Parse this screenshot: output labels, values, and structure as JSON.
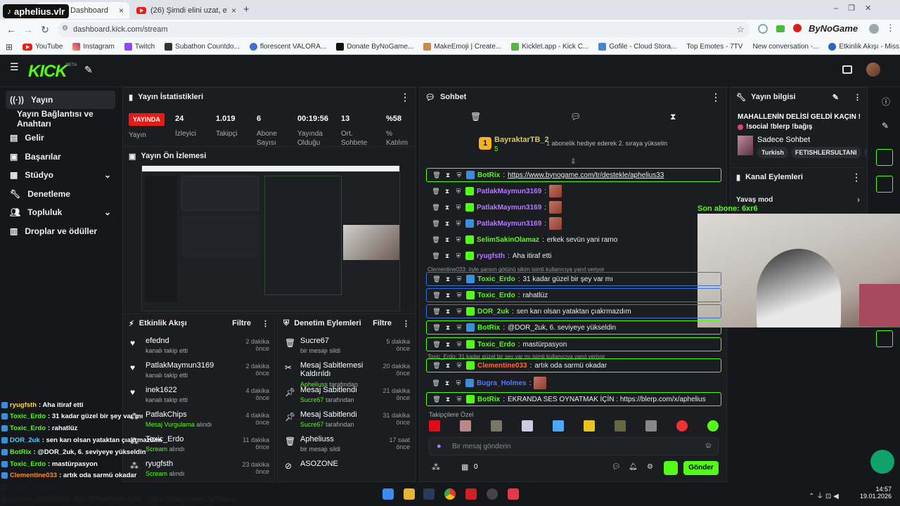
{
  "overlay_top": {
    "channel": "aphelius.vlr"
  },
  "browser": {
    "tabs": [
      {
        "label": "Dashboard",
        "close": "×"
      },
      {
        "label": "(26) Şimdi elini uzat, en güçlü o",
        "close": "×"
      }
    ],
    "new_tab": "+",
    "url": "dashboard.kick.com/stream",
    "profile_logo": "ByNoGame",
    "bookmarks": [
      "YouTube",
      "Instagram",
      "Twitch",
      "Subathon Countdo...",
      "florescent VALORA...",
      "Donate ByNoGame...",
      "MakeEmoji | Create...",
      "Kicklet.app - Kick C...",
      "Gofile - Cloud Stora...",
      "Top Emotes - 7TV",
      "New conversation -...",
      "Etkinlik Akışı - Miss..."
    ]
  },
  "kick": {
    "logo": "KICK",
    "logo_tag": "BETA",
    "sidebar": [
      {
        "label": "Yayın",
        "icon": "broadcast-icon"
      },
      {
        "label": "Yayın Bağlantısı ve Anahtarı",
        "icon": "none"
      },
      {
        "label": "Gelir",
        "icon": "wallet-icon"
      },
      {
        "label": "Başarılar",
        "icon": "trophy-icon"
      },
      {
        "label": "Stüdyo",
        "icon": "studio-icon"
      },
      {
        "label": "Denetleme",
        "icon": "wrench-icon"
      },
      {
        "label": "Topluluk",
        "icon": "users-icon"
      },
      {
        "label": "Droplar ve ödüller",
        "icon": "gift-icon"
      }
    ],
    "stats": {
      "title": "Yayın İstatistikleri",
      "live": "YAYINDA",
      "live_label": "Yayın",
      "items": [
        {
          "value": "24",
          "label": "İzleyici"
        },
        {
          "value": "1.019",
          "label": "Takipçi"
        },
        {
          "value": "6",
          "label": "Abone Sayısı"
        },
        {
          "value": "00:19:56",
          "label": "Yayında Olduğu"
        },
        {
          "value": "13",
          "label": "Ort. Sohbete"
        },
        {
          "value": "%58",
          "label": "% Katılım"
        }
      ]
    },
    "preview": {
      "title": "Yayın Ön İzlemesi"
    },
    "activity": {
      "title": "Etkinlik Akışı",
      "filter": "Filtre",
      "items": [
        {
          "name": "efednd",
          "sub": "kanalı takip etti",
          "time": "2 dakika önce",
          "icon": "heart-icon"
        },
        {
          "name": "PatlakMaymun3169",
          "sub": "kanalı takip etti",
          "time": "2 dakika önce",
          "icon": "heart-icon"
        },
        {
          "name": "inek1622",
          "sub": "kanalı takip etti",
          "time": "4 dakika önce",
          "icon": "heart-icon"
        },
        {
          "name": "PatlakChips",
          "sub_green": "Mesaj Vurgulama",
          "sub": " alındı",
          "time": "4 dakika önce",
          "icon": "points-icon"
        },
        {
          "name": "Toxic_Erdo",
          "sub_green": "Scream",
          "sub": " alındı",
          "time": "11 dakika önce",
          "icon": "points-icon"
        },
        {
          "name": "ryugfsth",
          "sub_green": "Scream",
          "sub": " alındı",
          "time": "23 dakika önce",
          "icon": "points-icon"
        }
      ]
    },
    "moderation": {
      "title": "Denetim Eylemleri",
      "filter": "Filtre",
      "items": [
        {
          "name": "Sucre67",
          "sub": "bir mesajı sildi",
          "time": "5 dakika önce",
          "icon": "trash-icon"
        },
        {
          "name": "Mesaj Sabitlemesi Kaldırıldı",
          "sub_green": "Apheliuss",
          "sub": " tarafından",
          "time": "20 dakika önce",
          "icon": "unpin-icon"
        },
        {
          "name": "Mesaj Sabitlendi",
          "sub_green": "Sucre67",
          "sub": " tarafından",
          "time": "21 dakika önce",
          "icon": "pin-icon"
        },
        {
          "name": "Mesaj Sabitlendi",
          "sub_green": "Sucre67",
          "sub": " tarafından",
          "time": "31 dakika önce",
          "icon": "pin-icon"
        },
        {
          "name": "Apheliuss",
          "sub": "bir mesajı sildi",
          "time": "17 saat önce",
          "icon": "trash-icon"
        },
        {
          "name": "ASOZONE",
          "sub": "",
          "time": "",
          "icon": "ban-icon"
        }
      ]
    },
    "chat": {
      "title": "Sohbet",
      "pinned_user": "BayraktarTB_2",
      "pinned_count": "5",
      "pinned_text": "1 abonelik hediye ederek 2. sıraya yükselin",
      "messages": [
        {
          "user": "BotRix",
          "color": "#53fc18",
          "text": "https://www.bynogame.com/tr/destekle/aphelius33",
          "link": true,
          "style": "hl",
          "emote": false
        },
        {
          "user": "PatlakMaymun3169",
          "color": "#b37bff",
          "text": "",
          "emote": true
        },
        {
          "user": "PatlakMaymun3169",
          "color": "#b37bff",
          "text": "",
          "emote": true
        },
        {
          "user": "PatlakMaymun3169",
          "color": "#b37bff",
          "text": "",
          "emote": true
        },
        {
          "user": "SelimSakinOlamaz",
          "color": "#53fc18",
          "text": "erkek sevün yani ramo",
          "emote": false
        },
        {
          "user": "ryugfsth",
          "color": "#b37bff",
          "text": "Aha itiraf etti",
          "emote": false
        },
        {
          "user": "Toxic_Erdo",
          "color": "#53fc18",
          "text": "31 kadar güzel bir şey var mı",
          "emote": false,
          "style": "hl2"
        },
        {
          "user": "Toxic_Erdo",
          "color": "#53fc18",
          "text": "rahatlüz",
          "emote": false,
          "style": "hl2"
        },
        {
          "user": "DOR_2uk",
          "color": "#53fc18",
          "text": "sen karı olsan yataktan çıakrmazdım",
          "emote": false,
          "style": "hl2"
        },
        {
          "user": "BotRix",
          "color": "#53fc18",
          "text": "@DOR_2uk, 6. seviyeye yükseldin",
          "emote": false,
          "style": "hl"
        },
        {
          "user": "Toxic_Erdo",
          "color": "#53fc18",
          "text": "mastürpasyon",
          "emote": false,
          "style": "hl"
        },
        {
          "user": "Clementine033",
          "color": "#ff6a3a",
          "text": "artık oda sarmü okadar",
          "emote": false,
          "style": "hl"
        },
        {
          "user": "Bugra_Holmes",
          "color": "#4f7cff",
          "text": "",
          "emote": true
        },
        {
          "user": "BotRix",
          "color": "#53fc18",
          "text": "EKRANDA SES OYNATMAK İÇİN : https://blerp.com/x/aphelius",
          "emote": false,
          "style": "hl"
        }
      ],
      "replies": [
        "Clementine033: öyle şansın götünü sikim isimli kullanıcıya yanıt veriyor",
        "Toxic_Erdo: 31 kadar güzel bir şey var mı isimli kullanıcıya yanıt veriyor"
      ],
      "followers_label": "Takipçilere Özel",
      "input_placeholder": "Bir mesaj gönderin",
      "points": "0",
      "send": "Gönder"
    },
    "stream_info": {
      "title": "Yayın bilgisi",
      "stream_title": "MAHALLENİN DELİSİ GELDİ KAÇIN !",
      "stream_subtitle": "!social !blerp !bağış",
      "category": "Sadece Sohbet",
      "tags": [
        "Turkish",
        "FETISHLERSULTANI",
        "T"
      ]
    },
    "channel_actions": {
      "title": "Kanal Eylemleri",
      "slow_mode": "Yavaş mod"
    },
    "last_sub": "Son abone: 6xr6"
  },
  "overlay_chat": [
    {
      "user": "ryugfsth",
      "color": "#ffd84a",
      "text": ": Aha itiraf etti"
    },
    {
      "user": "Toxic_Erdo",
      "color": "#53fc18",
      "text": ": 31 kadar güzel bir şey var mı"
    },
    {
      "user": "Toxic_Erdo",
      "color": "#53fc18",
      "text": ": rahatlüz"
    },
    {
      "user": "DOR_2uk",
      "color": "#4fd1ff",
      "text": ": sen karı olsan yataktan çıakrmazdım"
    },
    {
      "user": "BotRix",
      "color": "#53fc18",
      "text": ": @DOR_2uk, 6. seviyeye yükseldin"
    },
    {
      "user": "Toxic_Erdo",
      "color": "#53fc18",
      "text": ": mastürpasyon"
    },
    {
      "user": "Clementine033",
      "color": "#ff8a3a",
      "text": ": artık oda sarmü okadar"
    },
    {
      "user": "Bugra_Holmes",
      "color": "#4f7cff",
      "text": ":"
    },
    {
      "user": "BotRix",
      "color": "#53fc18",
      "text": ": EKRANDA SES OYNATMAK İÇİN : https://blerp.com/x/aphelius"
    }
  ],
  "taskbar": {
    "time": "14:57",
    "date": "19.01.2026"
  },
  "colors": {
    "kick_green": "#53fc18",
    "panel_bg": "#1b1d21",
    "live_red": "#e91916"
  }
}
